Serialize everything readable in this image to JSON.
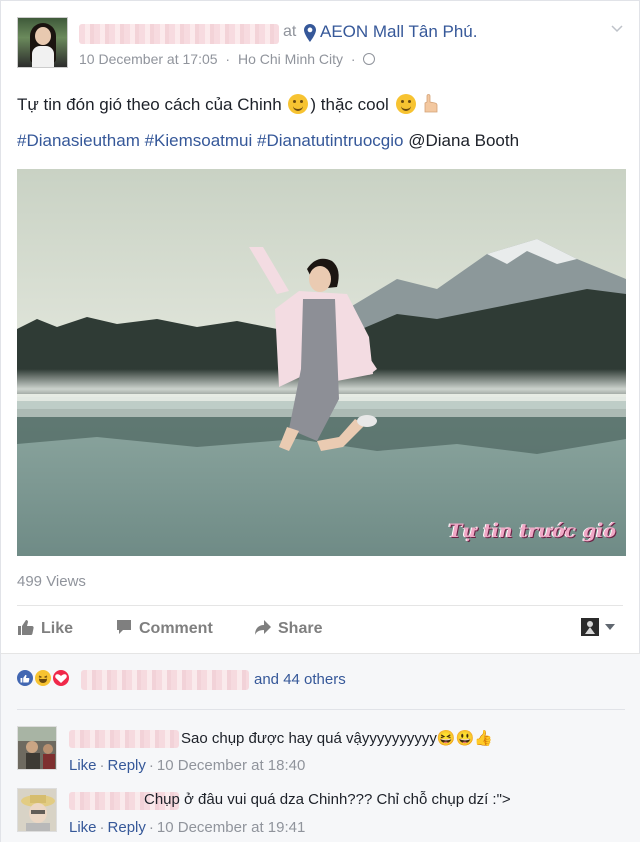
{
  "post": {
    "at_text": "at",
    "place": "AEON Mall Tân Phú.",
    "date": "10 December at 17:05",
    "location_sep": "·",
    "city": "Ho Chi Minh City",
    "meta_sep": "·",
    "text_before_emoji": "Tự tin đón gió theo cách của Chinh",
    "text_after_emoji": ") thặc cool",
    "hashtags": "#Dianasieutham #Kiemsoatmui #Dianatutintruocgio",
    "mention": "@Diana Booth",
    "photo_caption": "Tự tin trước gió",
    "views": "499 Views"
  },
  "actions": {
    "like_label": "Like",
    "comment_label": "Comment",
    "share_label": "Share"
  },
  "reactions": {
    "others_text": "and 44 others",
    "icons": [
      "like-icon",
      "haha-icon",
      "love-icon"
    ]
  },
  "comments": [
    {
      "text": "Sao chụp được hay quá vậyyyyyyyyyy😆😃👍",
      "like": "Like",
      "reply": "Reply",
      "sep": "·",
      "time": "10 December at 18:40"
    },
    {
      "text": "Chụp ở đâu vui quá dza Chinh??? Chỉ chỗ chụp dzí :\">",
      "like": "Like",
      "reply": "Reply",
      "sep": "·",
      "time": "10 December at 19:41"
    }
  ],
  "colors": {
    "link": "#365899",
    "muted": "#90949c",
    "like_reaction": "#4267b2",
    "love_reaction": "#f0284a",
    "haha_reaction": "#f7c331"
  }
}
